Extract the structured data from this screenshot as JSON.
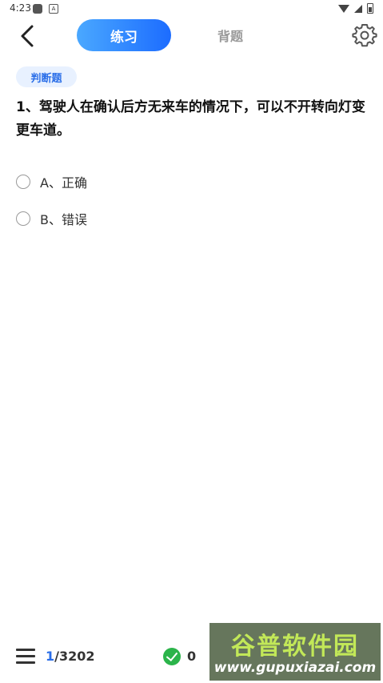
{
  "status_bar": {
    "time": "4:23",
    "notif_icon": "A"
  },
  "header": {
    "tab_active": "练习",
    "tab_inactive": "背题",
    "back_icon": "chevron-left-icon",
    "settings_icon": "gear-icon"
  },
  "question": {
    "type": "判断题",
    "text": "1、驾驶人在确认后方无来车的情况下，可以不开转向灯变更车道。",
    "options": [
      {
        "label": "A、正确"
      },
      {
        "label": "B、错误"
      }
    ]
  },
  "bottom": {
    "current": "1",
    "total": "/3202",
    "correct_count": "0"
  },
  "watermark": {
    "title": "谷普软件园",
    "url": "www.gupuxiazai.com"
  },
  "colors": {
    "accent": "#1c6cff",
    "correct": "#2bb44a"
  }
}
